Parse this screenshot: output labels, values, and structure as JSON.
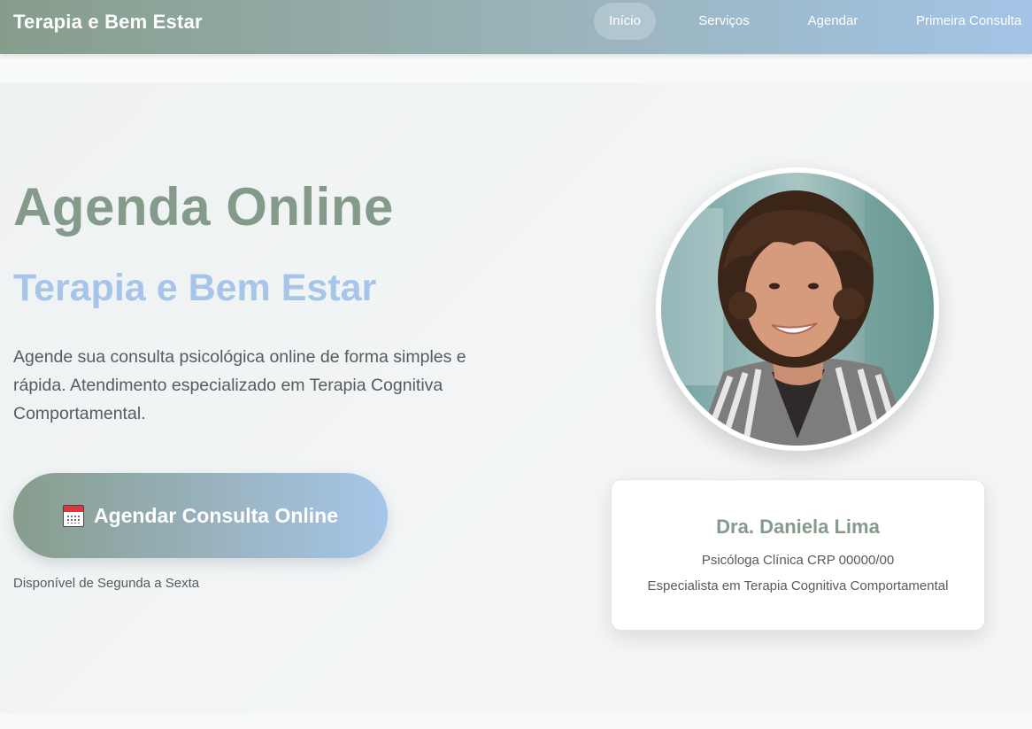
{
  "navbar": {
    "brand": "Terapia e Bem Estar",
    "links": [
      {
        "label": "Início",
        "active": true
      },
      {
        "label": "Serviços",
        "active": false
      },
      {
        "label": "Agendar",
        "active": false
      },
      {
        "label": "Primeira Consulta",
        "active": false
      }
    ]
  },
  "hero": {
    "title": "Agenda Online",
    "subtitle": "Terapia e Bem Estar",
    "description": "Agende sua consulta psicológica online de forma simples e rápida. Atendimento especializado em Terapia Cognitiva Comportamental.",
    "cta": {
      "icon": "calendar-icon",
      "label": "Agendar Consulta Online"
    },
    "availability": "Disponível de Segunda a Sexta"
  },
  "profile": {
    "photo": "psychologist-portrait",
    "name": "Dra. Daniela Lima",
    "credential": "Psicóloga Clínica CRP 00000/00",
    "specialty": "Especialista em Terapia Cognitiva Comportamental"
  },
  "colors": {
    "primary_green": "#849a8b",
    "accent_blue": "#a6c5e8",
    "text_gray": "#555b5e"
  }
}
